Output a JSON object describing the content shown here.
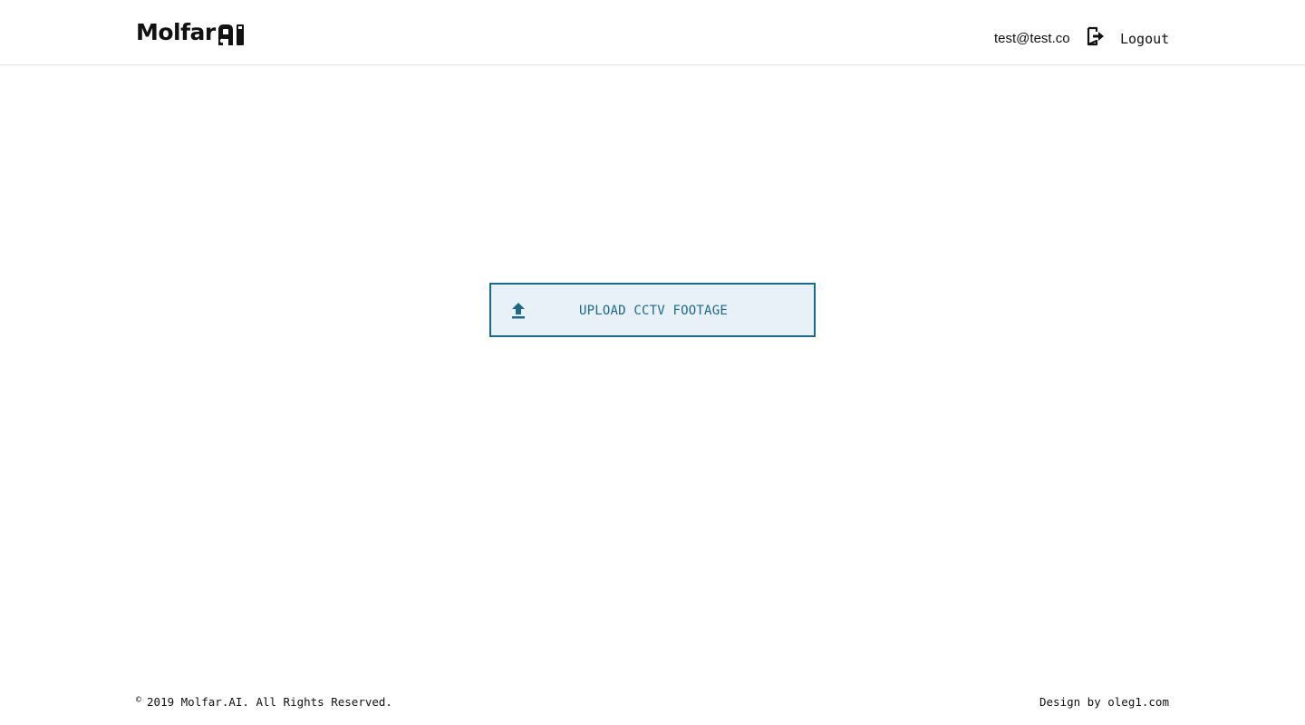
{
  "header": {
    "logo_text": "Molfar",
    "logo_mark_text": "AI",
    "user_email": "test@test.co",
    "logout_label": "Logout",
    "logout_icon": "logout-icon"
  },
  "main": {
    "upload_button_label": "UPLOAD CCTV FOOTAGE",
    "upload_icon": "upload-icon"
  },
  "footer": {
    "copyright_symbol": "©",
    "copyright_text": "2019 Molfar.AI. All Rights Reserved.",
    "credit_text": "Design by oleg1.com"
  },
  "colors": {
    "accent": "#1a6a8c",
    "button_background": "#e8f0f8",
    "text": "#111111",
    "background": "#ffffff"
  }
}
